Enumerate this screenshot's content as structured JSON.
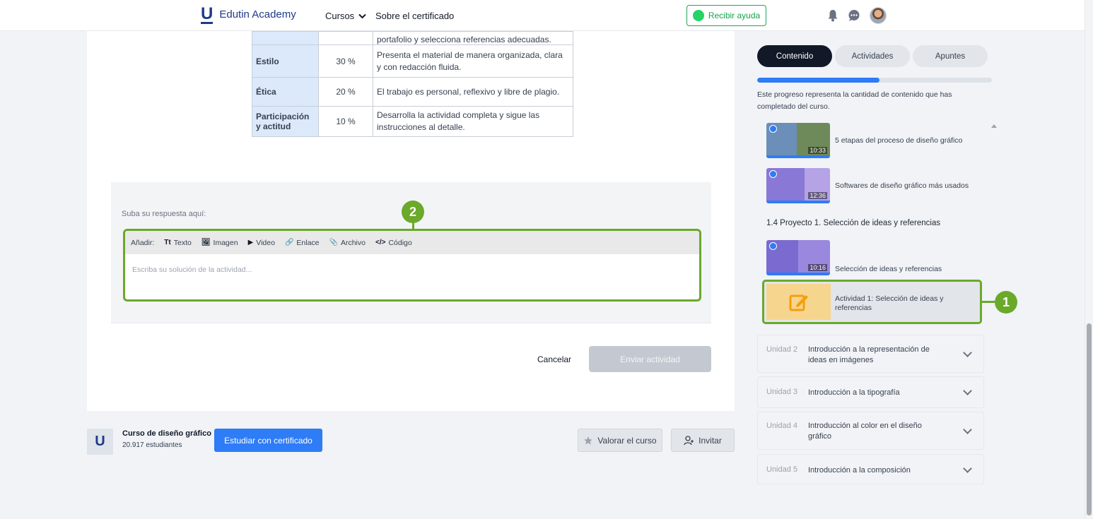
{
  "header": {
    "logo_mark": "U",
    "logo_text": "Edutin Academy",
    "nav_courses": "Cursos",
    "nav_certificate": "Sobre el certificado",
    "help_button": "Recibir ayuda"
  },
  "rubric": {
    "partial_text": "portafolio y selecciona referencias adecuadas.",
    "rows": [
      {
        "criterion": "Estilo",
        "percent": "30 %",
        "description": "Presenta el material de manera organizada, clara y con redacción fluida."
      },
      {
        "criterion": "Ética",
        "percent": "20 %",
        "description": "El trabajo es personal, reflexivo y libre de plagio."
      },
      {
        "criterion": "Participación y actitud",
        "percent": "10 %",
        "description": "Desarrolla la actividad completa y sigue las instrucciones al detalle."
      }
    ]
  },
  "answer": {
    "label": "Suba su respuesta aquí:",
    "add_label": "Añadir:",
    "tools": [
      {
        "icon": "Tt",
        "label": "Texto"
      },
      {
        "icon": "🖼",
        "label": "Imagen"
      },
      {
        "icon": "▶",
        "label": "Video"
      },
      {
        "icon": "🔗",
        "label": "Enlace"
      },
      {
        "icon": "📎",
        "label": "Archivo"
      },
      {
        "icon": "</>",
        "label": "Código"
      }
    ],
    "placeholder": "Escriba su solución de la actividad...",
    "cancel": "Cancelar",
    "send": "Enviar actividad"
  },
  "annotations": {
    "badge_1": "1",
    "badge_2": "2"
  },
  "course_footer": {
    "logo_mark": "U",
    "name": "Curso de diseño gráfico",
    "students": "20.917 estudiantes",
    "study_button": "Estudiar con certificado",
    "rate_button": "Valorar el curso",
    "invite_button": "Invitar"
  },
  "sidebar": {
    "tabs": [
      "Contenido",
      "Actividades",
      "Apuntes"
    ],
    "progress_fraction": 0.52,
    "progress_text": "Este progreso representa la cantidad de contenido que has completado del curso.",
    "lessons": [
      {
        "title": "5 etapas del proceso de diseño gráfico",
        "duration": "10:33"
      },
      {
        "title": "Softwares de diseño gráfico más usados",
        "duration": "12:36"
      }
    ],
    "section": "1.4  Proyecto 1. Selección de ideas y referencias",
    "section_lesson": {
      "title": "Selección de ideas y referencias",
      "duration": "10:16"
    },
    "activity_title": "Actividad 1: Selección de ideas y referencias",
    "units": [
      {
        "num": "Unidad 2",
        "name": "Introducción a la representación de ideas en imágenes"
      },
      {
        "num": "Unidad 3",
        "name": "Introducción a la tipografía"
      },
      {
        "num": "Unidad 4",
        "name": "Introducción al color en el diseño gráfico"
      },
      {
        "num": "Unidad 5",
        "name": "Introducción a la composición"
      }
    ]
  },
  "colors": {
    "accent": "#2e7cf6",
    "annotation": "#6aa92a",
    "brand": "#1e3a8a"
  }
}
